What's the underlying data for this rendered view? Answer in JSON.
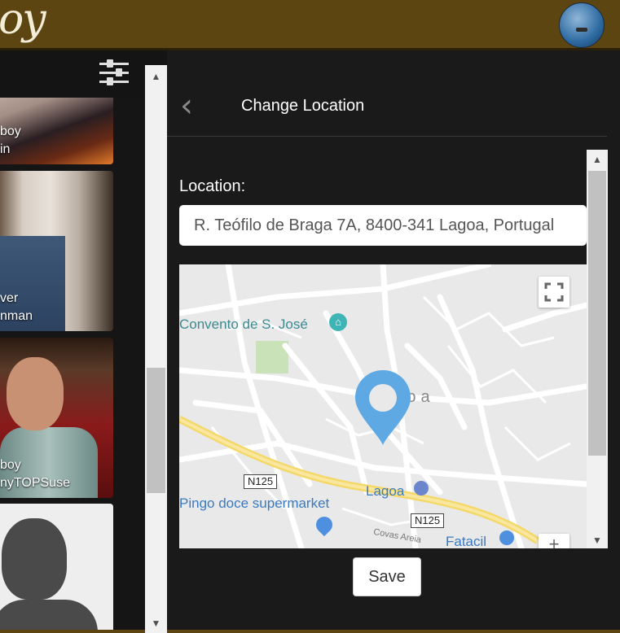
{
  "header": {
    "logo_text": "oy",
    "avatar_icon": "avatar-photo-icon"
  },
  "cards": [
    {
      "line1": "boy",
      "line2": "in"
    },
    {
      "line1": "ver",
      "line2": "nman"
    },
    {
      "line1": "boy",
      "line2": "nyTOPSuse"
    },
    {
      "line1": "",
      "line2": ""
    }
  ],
  "filter": {
    "icon": "sliders-icon"
  },
  "location_panel": {
    "title": "Change Location",
    "location_label": "Location:",
    "location_value": "R. Teófilo de Braga 7A, 8400-341 Lagoa, Portugal",
    "save_label": "Save"
  },
  "map": {
    "pois": [
      "Convento de S. José",
      "Lagoa",
      "Pingo doce supermarket",
      "Fatacil"
    ],
    "town_label": "Lagoa",
    "roads": [
      "N125",
      "N125"
    ],
    "street": "Covas Areia",
    "zoom_in": "+"
  },
  "colors": {
    "header": "#5c4511",
    "marker": "#5ea8e3",
    "background": "#1a1a1a"
  }
}
